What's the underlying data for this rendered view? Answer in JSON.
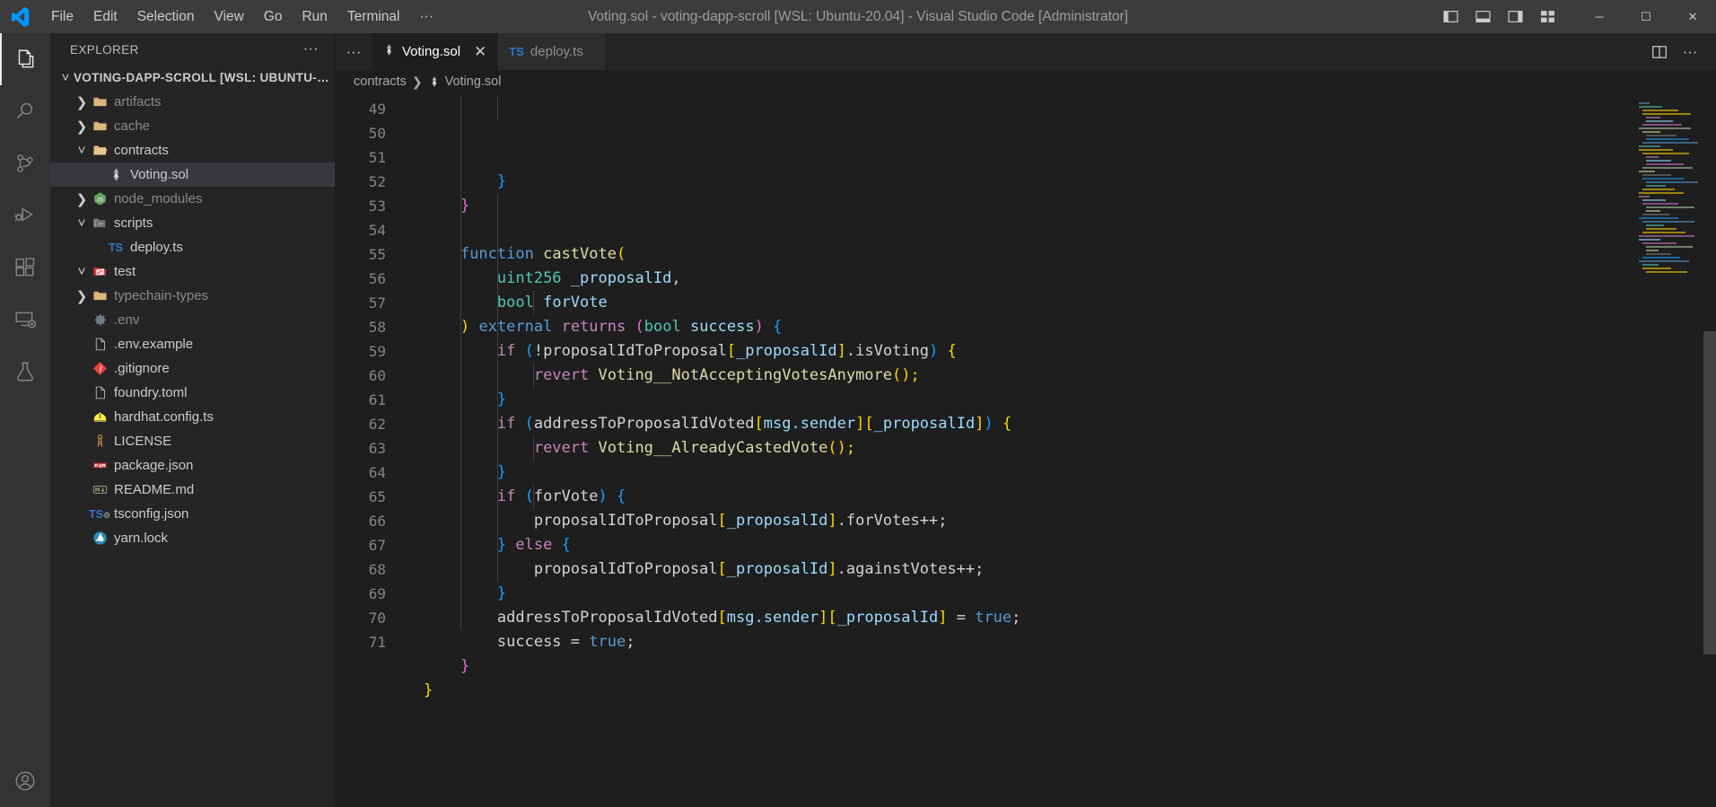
{
  "titlebar": {
    "title": "Voting.sol - voting-dapp-scroll [WSL: Ubuntu-20.04] - Visual Studio Code [Administrator]",
    "menus": [
      "File",
      "Edit",
      "Selection",
      "View",
      "Go",
      "Run",
      "Terminal",
      "···"
    ],
    "logo_icon": "vscode-logo-icon",
    "layout_icons": [
      "toggle-primary-sidebar-icon",
      "toggle-panel-icon",
      "toggle-secondary-sidebar-icon",
      "customize-layout-icon"
    ],
    "window_controls": {
      "minimize": "─",
      "maximize": "☐",
      "close": "✕"
    }
  },
  "activitybar": {
    "items": [
      {
        "name": "explorer",
        "icon": "files-icon",
        "active": true
      },
      {
        "name": "search",
        "icon": "search-icon",
        "active": false
      },
      {
        "name": "source-control",
        "icon": "source-control-icon",
        "active": false
      },
      {
        "name": "run-and-debug",
        "icon": "debug-icon",
        "active": false
      },
      {
        "name": "extensions",
        "icon": "extensions-icon",
        "active": false
      },
      {
        "name": "remote-explorer",
        "icon": "remote-explorer-icon",
        "active": false
      },
      {
        "name": "testing",
        "icon": "beaker-icon",
        "active": false
      }
    ],
    "bottom": [
      {
        "name": "accounts",
        "icon": "account-icon"
      }
    ]
  },
  "sidebar": {
    "header": "EXPLORER",
    "more_actions": "···",
    "root": {
      "label": "VOTING-DAPP-SCROLL [WSL: UBUNTU-20....",
      "expanded": true
    },
    "items": [
      {
        "label": "artifacts",
        "indent": 1,
        "twisty": "collapsed",
        "icon": "folder-icon",
        "selected": false,
        "dim": true
      },
      {
        "label": "cache",
        "indent": 1,
        "twisty": "collapsed",
        "icon": "folder-icon",
        "selected": false,
        "dim": true
      },
      {
        "label": "contracts",
        "indent": 1,
        "twisty": "expanded",
        "icon": "folder-open-icon",
        "selected": false,
        "dim": false
      },
      {
        "label": "Voting.sol",
        "indent": 2,
        "twisty": "none",
        "icon": "solidity-icon",
        "selected": true,
        "dim": false
      },
      {
        "label": "node_modules",
        "indent": 1,
        "twisty": "collapsed",
        "icon": "nodejs-icon",
        "selected": false,
        "dim": true
      },
      {
        "label": "scripts",
        "indent": 1,
        "twisty": "expanded",
        "icon": "scripts-icon",
        "selected": false,
        "dim": false
      },
      {
        "label": "deploy.ts",
        "indent": 2,
        "twisty": "none",
        "icon": "typescript-icon",
        "selected": false,
        "dim": false
      },
      {
        "label": "test",
        "indent": 1,
        "twisty": "expanded",
        "icon": "test-icon",
        "selected": false,
        "dim": false
      },
      {
        "label": "typechain-types",
        "indent": 1,
        "twisty": "collapsed",
        "icon": "folder-icon",
        "selected": false,
        "dim": true
      },
      {
        "label": ".env",
        "indent": 1,
        "twisty": "none",
        "icon": "gear-icon",
        "selected": false,
        "dim": true
      },
      {
        "label": ".env.example",
        "indent": 1,
        "twisty": "none",
        "icon": "file-icon",
        "selected": false,
        "dim": false
      },
      {
        "label": ".gitignore",
        "indent": 1,
        "twisty": "none",
        "icon": "git-icon",
        "selected": false,
        "dim": false
      },
      {
        "label": "foundry.toml",
        "indent": 1,
        "twisty": "none",
        "icon": "file-icon",
        "selected": false,
        "dim": false
      },
      {
        "label": "hardhat.config.ts",
        "indent": 1,
        "twisty": "none",
        "icon": "hardhat-icon",
        "selected": false,
        "dim": false
      },
      {
        "label": "LICENSE",
        "indent": 1,
        "twisty": "none",
        "icon": "license-key-icon",
        "selected": false,
        "dim": false
      },
      {
        "label": "package.json",
        "indent": 1,
        "twisty": "none",
        "icon": "npm-icon",
        "selected": false,
        "dim": false
      },
      {
        "label": "README.md",
        "indent": 1,
        "twisty": "none",
        "icon": "markdown-icon",
        "selected": false,
        "dim": false
      },
      {
        "label": "tsconfig.json",
        "indent": 1,
        "twisty": "none",
        "icon": "tsconfig-icon",
        "selected": false,
        "dim": false
      },
      {
        "label": "yarn.lock",
        "indent": 1,
        "twisty": "none",
        "icon": "yarn-icon",
        "selected": false,
        "dim": false
      }
    ]
  },
  "editor": {
    "overflow_icon": "···",
    "tabs": [
      {
        "label": "Voting.sol",
        "icon": "solidity-icon",
        "active": true,
        "close": "✕"
      },
      {
        "label": "deploy.ts",
        "icon": "typescript-icon",
        "active": false,
        "close": ""
      }
    ],
    "actions": [
      {
        "name": "split-editor",
        "icon": "split-editor-icon"
      },
      {
        "name": "more-actions",
        "icon": "ellipsis-icon",
        "glyph": "···"
      }
    ],
    "breadcrumb": [
      {
        "label": "contracts",
        "icon": ""
      },
      {
        "label": "Voting.sol",
        "icon": "solidity-icon"
      }
    ],
    "first_line_number": 49,
    "lines": [
      {
        "n": 49,
        "tokens": [
          {
            "t": "        ",
            "c": "txt"
          },
          {
            "t": "}",
            "c": "bb"
          }
        ]
      },
      {
        "n": 50,
        "tokens": [
          {
            "t": "    ",
            "c": "txt"
          },
          {
            "t": "}",
            "c": "bp"
          }
        ]
      },
      {
        "n": 51,
        "tokens": []
      },
      {
        "n": 52,
        "tokens": [
          {
            "t": "    ",
            "c": "txt"
          },
          {
            "t": "function",
            "c": "kw"
          },
          {
            "t": " ",
            "c": "txt"
          },
          {
            "t": "castVote",
            "c": "fn"
          },
          {
            "t": "(",
            "c": "bl"
          }
        ]
      },
      {
        "n": 53,
        "tokens": [
          {
            "t": "        ",
            "c": "txt"
          },
          {
            "t": "uint256",
            "c": "type"
          },
          {
            "t": " ",
            "c": "txt"
          },
          {
            "t": "_proposalId",
            "c": "var"
          },
          {
            "t": ",",
            "c": "txt"
          }
        ]
      },
      {
        "n": 54,
        "tokens": [
          {
            "t": "        ",
            "c": "txt"
          },
          {
            "t": "bool",
            "c": "type"
          },
          {
            "t": " ",
            "c": "txt"
          },
          {
            "t": "forVote",
            "c": "var"
          }
        ]
      },
      {
        "n": 55,
        "tokens": [
          {
            "t": "    ",
            "c": "txt"
          },
          {
            "t": ")",
            "c": "bl"
          },
          {
            "t": " ",
            "c": "txt"
          },
          {
            "t": "external",
            "c": "kw"
          },
          {
            "t": " ",
            "c": "txt"
          },
          {
            "t": "returns",
            "c": "ctl"
          },
          {
            "t": " ",
            "c": "txt"
          },
          {
            "t": "(",
            "c": "bp"
          },
          {
            "t": "bool",
            "c": "type"
          },
          {
            "t": " ",
            "c": "txt"
          },
          {
            "t": "success",
            "c": "var"
          },
          {
            "t": ")",
            "c": "bp"
          },
          {
            "t": " ",
            "c": "txt"
          },
          {
            "t": "{",
            "c": "bb"
          }
        ]
      },
      {
        "n": 56,
        "tokens": [
          {
            "t": "        ",
            "c": "txt"
          },
          {
            "t": "if",
            "c": "ctl"
          },
          {
            "t": " ",
            "c": "txt"
          },
          {
            "t": "(",
            "c": "bb"
          },
          {
            "t": "!proposalIdToProposal",
            "c": "txt"
          },
          {
            "t": "[",
            "c": "bl"
          },
          {
            "t": "_proposalId",
            "c": "var"
          },
          {
            "t": "]",
            "c": "bl"
          },
          {
            "t": ".isVoting",
            "c": "txt"
          },
          {
            "t": ")",
            "c": "bb"
          },
          {
            "t": " ",
            "c": "txt"
          },
          {
            "t": "{",
            "c": "bl"
          }
        ]
      },
      {
        "n": 57,
        "tokens": [
          {
            "t": "            ",
            "c": "txt"
          },
          {
            "t": "revert",
            "c": "ctl"
          },
          {
            "t": " ",
            "c": "txt"
          },
          {
            "t": "Voting__NotAcceptingVotesAnymore",
            "c": "fn"
          },
          {
            "t": "();",
            "c": "bo"
          }
        ]
      },
      {
        "n": 58,
        "tokens": [
          {
            "t": "        ",
            "c": "txt"
          },
          {
            "t": "}",
            "c": "bb"
          }
        ]
      },
      {
        "n": 59,
        "tokens": [
          {
            "t": "        ",
            "c": "txt"
          },
          {
            "t": "if",
            "c": "ctl"
          },
          {
            "t": " ",
            "c": "txt"
          },
          {
            "t": "(",
            "c": "bb"
          },
          {
            "t": "addressToProposalIdVoted",
            "c": "txt"
          },
          {
            "t": "[",
            "c": "bl"
          },
          {
            "t": "msg.sender",
            "c": "var"
          },
          {
            "t": "]",
            "c": "bl"
          },
          {
            "t": "[",
            "c": "bl"
          },
          {
            "t": "_proposalId",
            "c": "var"
          },
          {
            "t": "]",
            "c": "bl"
          },
          {
            "t": ")",
            "c": "bb"
          },
          {
            "t": " ",
            "c": "txt"
          },
          {
            "t": "{",
            "c": "bl"
          }
        ]
      },
      {
        "n": 60,
        "tokens": [
          {
            "t": "            ",
            "c": "txt"
          },
          {
            "t": "revert",
            "c": "ctl"
          },
          {
            "t": " ",
            "c": "txt"
          },
          {
            "t": "Voting__AlreadyCastedVote",
            "c": "fn"
          },
          {
            "t": "();",
            "c": "bo"
          }
        ]
      },
      {
        "n": 61,
        "tokens": [
          {
            "t": "        ",
            "c": "txt"
          },
          {
            "t": "}",
            "c": "bb"
          }
        ]
      },
      {
        "n": 62,
        "tokens": [
          {
            "t": "        ",
            "c": "txt"
          },
          {
            "t": "if",
            "c": "ctl"
          },
          {
            "t": " ",
            "c": "txt"
          },
          {
            "t": "(",
            "c": "bb"
          },
          {
            "t": "forVote",
            "c": "txt"
          },
          {
            "t": ")",
            "c": "bb"
          },
          {
            "t": " ",
            "c": "txt"
          },
          {
            "t": "{",
            "c": "bb"
          }
        ]
      },
      {
        "n": 63,
        "tokens": [
          {
            "t": "            ",
            "c": "txt"
          },
          {
            "t": "proposalIdToProposal",
            "c": "txt"
          },
          {
            "t": "[",
            "c": "bl"
          },
          {
            "t": "_proposalId",
            "c": "var"
          },
          {
            "t": "]",
            "c": "bl"
          },
          {
            "t": ".forVotes++;",
            "c": "txt"
          }
        ]
      },
      {
        "n": 64,
        "tokens": [
          {
            "t": "        ",
            "c": "txt"
          },
          {
            "t": "}",
            "c": "bb"
          },
          {
            "t": " ",
            "c": "txt"
          },
          {
            "t": "else",
            "c": "ctl"
          },
          {
            "t": " ",
            "c": "txt"
          },
          {
            "t": "{",
            "c": "bb"
          }
        ]
      },
      {
        "n": 65,
        "tokens": [
          {
            "t": "            ",
            "c": "txt"
          },
          {
            "t": "proposalIdToProposal",
            "c": "txt"
          },
          {
            "t": "[",
            "c": "bl"
          },
          {
            "t": "_proposalId",
            "c": "var"
          },
          {
            "t": "]",
            "c": "bl"
          },
          {
            "t": ".againstVotes++;",
            "c": "txt"
          }
        ]
      },
      {
        "n": 66,
        "tokens": [
          {
            "t": "        ",
            "c": "txt"
          },
          {
            "t": "}",
            "c": "bb"
          }
        ]
      },
      {
        "n": 67,
        "tokens": [
          {
            "t": "        ",
            "c": "txt"
          },
          {
            "t": "addressToProposalIdVoted",
            "c": "txt"
          },
          {
            "t": "[",
            "c": "bl"
          },
          {
            "t": "msg.sender",
            "c": "var"
          },
          {
            "t": "]",
            "c": "bl"
          },
          {
            "t": "[",
            "c": "bl"
          },
          {
            "t": "_proposalId",
            "c": "var"
          },
          {
            "t": "]",
            "c": "bl"
          },
          {
            "t": " = ",
            "c": "txt"
          },
          {
            "t": "true",
            "c": "kw"
          },
          {
            "t": ";",
            "c": "txt"
          }
        ]
      },
      {
        "n": 68,
        "tokens": [
          {
            "t": "        ",
            "c": "txt"
          },
          {
            "t": "success",
            "c": "txt"
          },
          {
            "t": " = ",
            "c": "txt"
          },
          {
            "t": "true",
            "c": "kw"
          },
          {
            "t": ";",
            "c": "txt"
          }
        ]
      },
      {
        "n": 69,
        "tokens": [
          {
            "t": "    ",
            "c": "txt"
          },
          {
            "t": "}",
            "c": "bp"
          }
        ]
      },
      {
        "n": 70,
        "tokens": [
          {
            "t": "}",
            "c": "bl"
          }
        ]
      },
      {
        "n": 71,
        "tokens": []
      }
    ]
  },
  "colors": {
    "titlebar_bg": "#3c3c3c",
    "activitybar_bg": "#333333",
    "sidebar_bg": "#252526",
    "editor_bg": "#1e1e1e",
    "tab_active_bg": "#1e1e1e",
    "tab_inactive_bg": "#2d2d2d",
    "selection_bg": "#37373d",
    "accent": "#0078d4",
    "line_number": "#858585"
  }
}
